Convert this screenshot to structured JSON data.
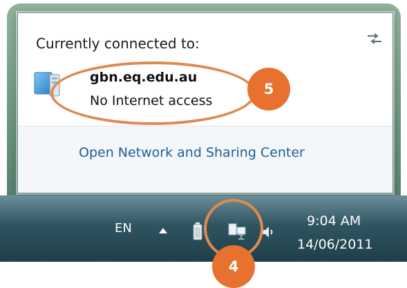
{
  "flyout": {
    "header": "Currently connected to:",
    "network": {
      "name": "gbn.eq.edu.au",
      "status": "No Internet access"
    },
    "open_link": "Open Network and Sharing Center"
  },
  "taskbar": {
    "language": "EN",
    "time": "9:04 AM",
    "date": "14/06/2011",
    "icons": [
      "show-hidden-icons-arrow",
      "battery-icon",
      "network-icon",
      "speaker-icon"
    ]
  },
  "annotations": {
    "marker_5": "5",
    "marker_4": "4",
    "accent_color": "#e8712f"
  }
}
